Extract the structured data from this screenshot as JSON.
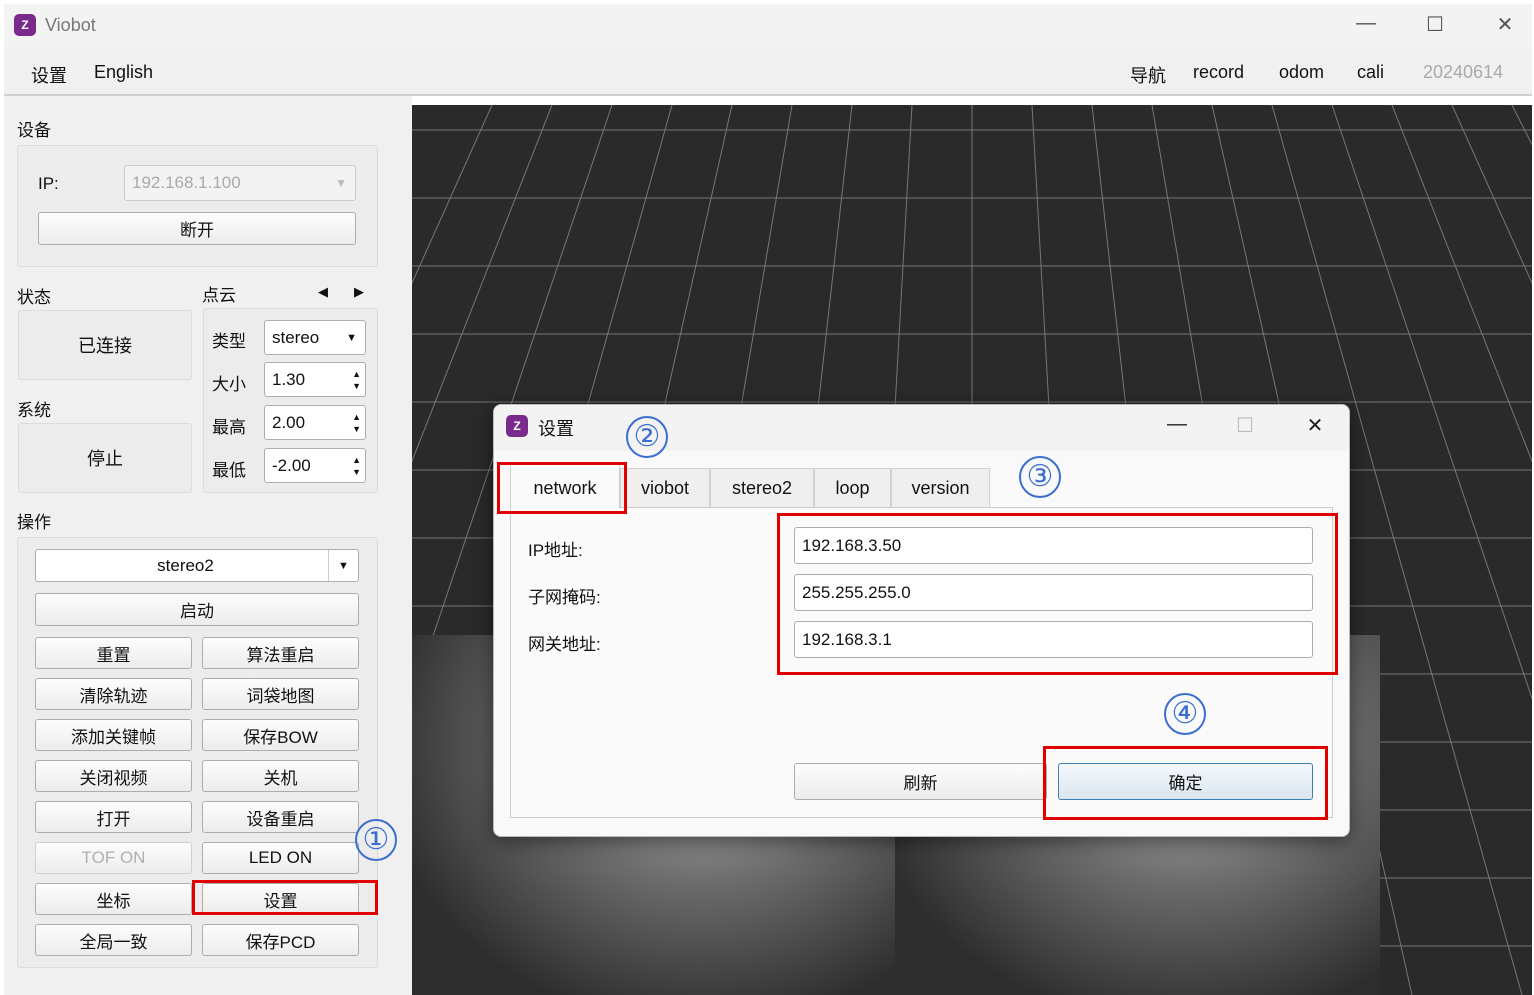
{
  "window": {
    "title": "Viobot",
    "logo": "Z"
  },
  "toolbar": {
    "left": [
      "设置",
      "English"
    ],
    "right": [
      "导航",
      "record",
      "odom",
      "cali"
    ],
    "version": "20240614"
  },
  "device": {
    "title": "设备",
    "ip_label": "IP:",
    "ip_value": "192.168.1.100",
    "disconnect": "断开"
  },
  "status": {
    "title": "状态",
    "value": "已连接"
  },
  "system": {
    "title": "系统",
    "value": "停止"
  },
  "pointcloud": {
    "title": "点云",
    "type_label": "类型",
    "type_value": "stereo",
    "size_label": "大小",
    "size_value": "1.30",
    "max_label": "最高",
    "max_value": "2.00",
    "min_label": "最低",
    "min_value": "-2.00"
  },
  "ops": {
    "title": "操作",
    "mode": "stereo2",
    "start": "启动",
    "buttons": [
      "重置",
      "算法重启",
      "清除轨迹",
      "词袋地图",
      "添加关键帧",
      "保存BOW",
      "关闭视频",
      "关机",
      "打开",
      "设备重启",
      "TOF ON",
      "LED ON",
      "坐标",
      "设置",
      "全局一致",
      "保存PCD"
    ]
  },
  "dialog": {
    "title": "设置",
    "tabs": [
      "network",
      "viobot",
      "stereo2",
      "loop",
      "version"
    ],
    "fields": [
      {
        "label": "IP地址:",
        "value": "192.168.3.50"
      },
      {
        "label": "子网掩码:",
        "value": "255.255.255.0"
      },
      {
        "label": "网关地址:",
        "value": "192.168.3.1"
      }
    ],
    "refresh": "刷新",
    "ok": "确定"
  },
  "annotations": [
    "①",
    "②",
    "③",
    "④"
  ]
}
